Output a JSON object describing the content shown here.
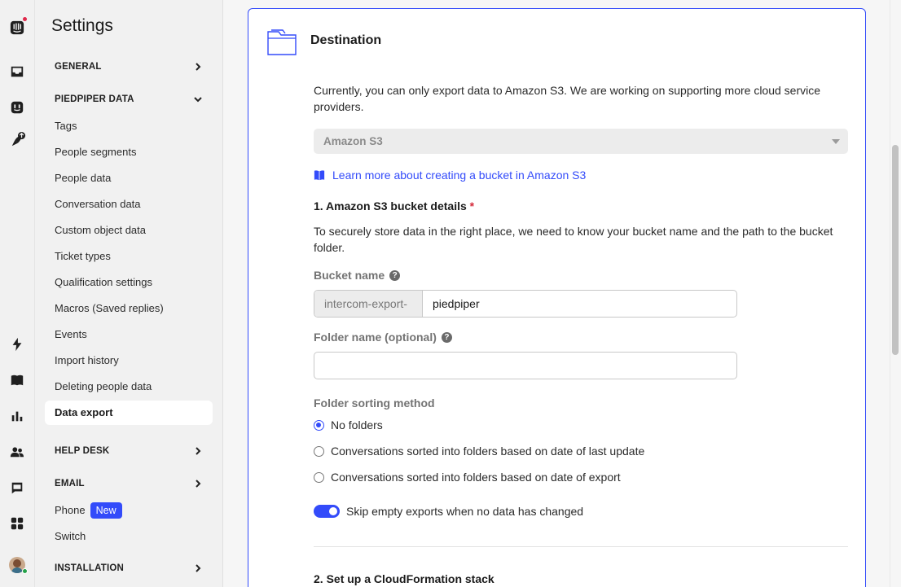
{
  "sidebar": {
    "title": "Settings",
    "sections": {
      "general": "GENERAL",
      "piedpiper_data": "PIEDPIPER DATA",
      "help_desk": "HELP DESK",
      "email": "EMAIL",
      "installation": "INSTALLATION"
    },
    "items": {
      "tags": "Tags",
      "people_segments": "People segments",
      "people_data": "People data",
      "conversation_data": "Conversation data",
      "custom_object_data": "Custom object data",
      "ticket_types": "Ticket types",
      "qualification_settings": "Qualification settings",
      "macros": "Macros (Saved replies)",
      "events": "Events",
      "import_history": "Import history",
      "deleting_people_data": "Deleting people data",
      "data_export": "Data export",
      "phone": "Phone",
      "phone_badge": "New",
      "switch": "Switch"
    }
  },
  "card": {
    "title": "Destination",
    "intro": "Currently, you can only export data to Amazon S3. We are working on supporting more cloud service providers.",
    "provider_selected": "Amazon S3",
    "learn_link": "Learn more about creating a bucket in Amazon S3",
    "step1_title": "1. Amazon S3 bucket details",
    "required_mark": "*",
    "step1_desc": "To securely store data in the right place, we need to know your bucket name and the path to the bucket folder.",
    "bucket_label": "Bucket name",
    "bucket_prefix": "intercom-export-",
    "bucket_value": "piedpiper",
    "folder_label": "Folder name (optional)",
    "folder_value": "",
    "sorting_label": "Folder sorting method",
    "sorting_options": [
      "No folders",
      "Conversations sorted into folders based on date of last update",
      "Conversations sorted into folders based on date of export"
    ],
    "sorting_selected": "No folders",
    "skip_toggle_label": "Skip empty exports when no data has changed",
    "skip_toggle_on": true,
    "step2_title": "2. Set up a CloudFormation stack"
  },
  "colors": {
    "accent": "#334bfa",
    "required": "#d42a3a"
  }
}
